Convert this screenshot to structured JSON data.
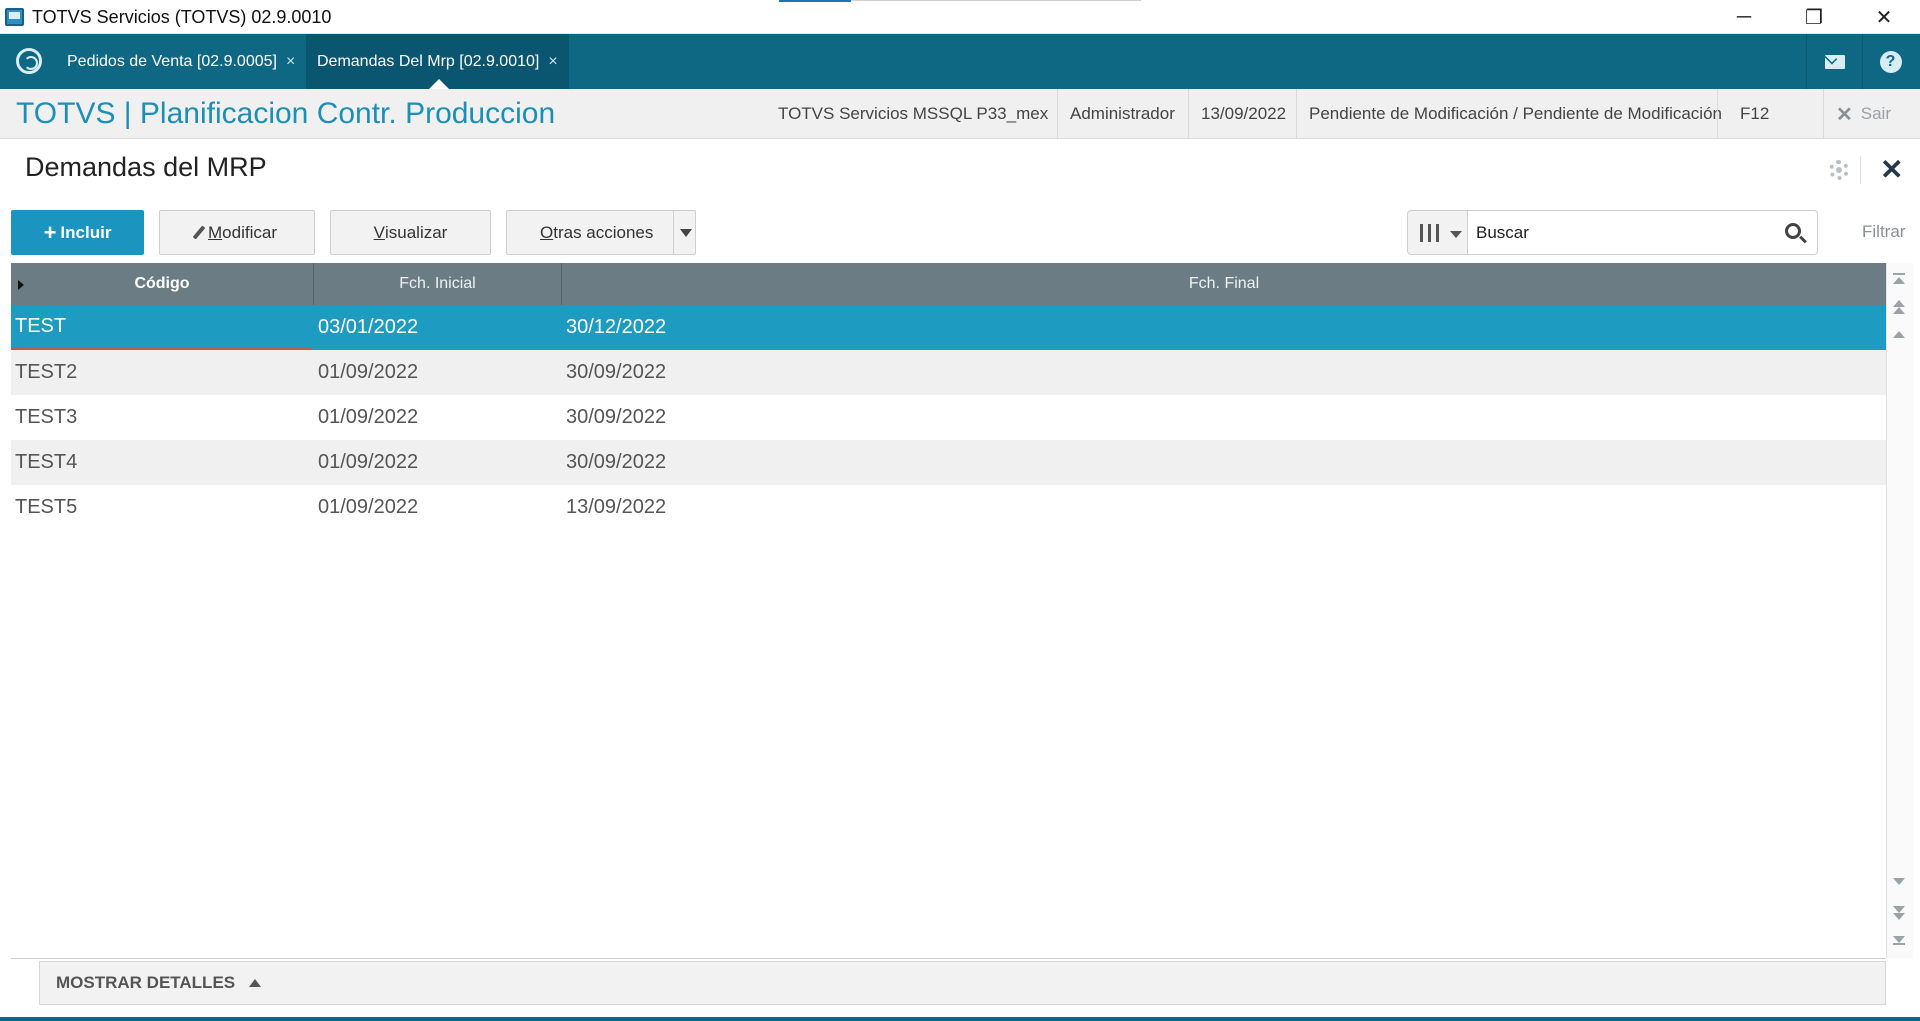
{
  "window": {
    "title": "TOTVS Servicios (TOTVS) 02.9.0010",
    "minimize": "─",
    "maximize": "❐",
    "close": "✕"
  },
  "app_tabs": [
    {
      "label": "Pedidos de Venta [02.9.0005]",
      "close": "×"
    },
    {
      "label": "Demandas Del Mrp [02.9.0010]",
      "close": "×"
    }
  ],
  "header": {
    "app_title": "TOTVS | Planificacion Contr. Produccion",
    "company": "TOTVS Servicios MSSQL P33_mex",
    "user": "Administrador",
    "date": "13/09/2022",
    "status": "Pendiente de Modificación / Pendiente de Modificación",
    "shortcut": "F12",
    "exit_label": "Sair",
    "exit_icon": "✕"
  },
  "page": {
    "title": "Demandas del MRP",
    "close": "✕"
  },
  "toolbar": {
    "include_plus": "+",
    "include_label": "Incluir",
    "modify_first": "M",
    "modify_rest": "odificar",
    "view_first": "V",
    "view_rest": "isualizar",
    "other_first": "O",
    "other_rest": "tras acciones",
    "search_placeholder": "Buscar",
    "filter_label": "Filtrar"
  },
  "grid": {
    "columns": [
      "Código",
      "Fch. Inicial",
      "Fch. Final"
    ],
    "rows": [
      {
        "codigo": "TEST",
        "inicial": "03/01/2022",
        "final": "30/12/2022"
      },
      {
        "codigo": "TEST2",
        "inicial": "01/09/2022",
        "final": "30/09/2022"
      },
      {
        "codigo": "TEST3",
        "inicial": "01/09/2022",
        "final": "30/09/2022"
      },
      {
        "codigo": "TEST4",
        "inicial": "01/09/2022",
        "final": "30/09/2022"
      },
      {
        "codigo": "TEST5",
        "inicial": "01/09/2022",
        "final": "13/09/2022"
      }
    ]
  },
  "footer": {
    "details_label": "MOSTRAR DETALLES"
  },
  "colors": {
    "tabbar": "#0e6783",
    "accent": "#1b95c0",
    "selected_row": "#1e9bc0",
    "grid_header": "#6b7c85"
  }
}
